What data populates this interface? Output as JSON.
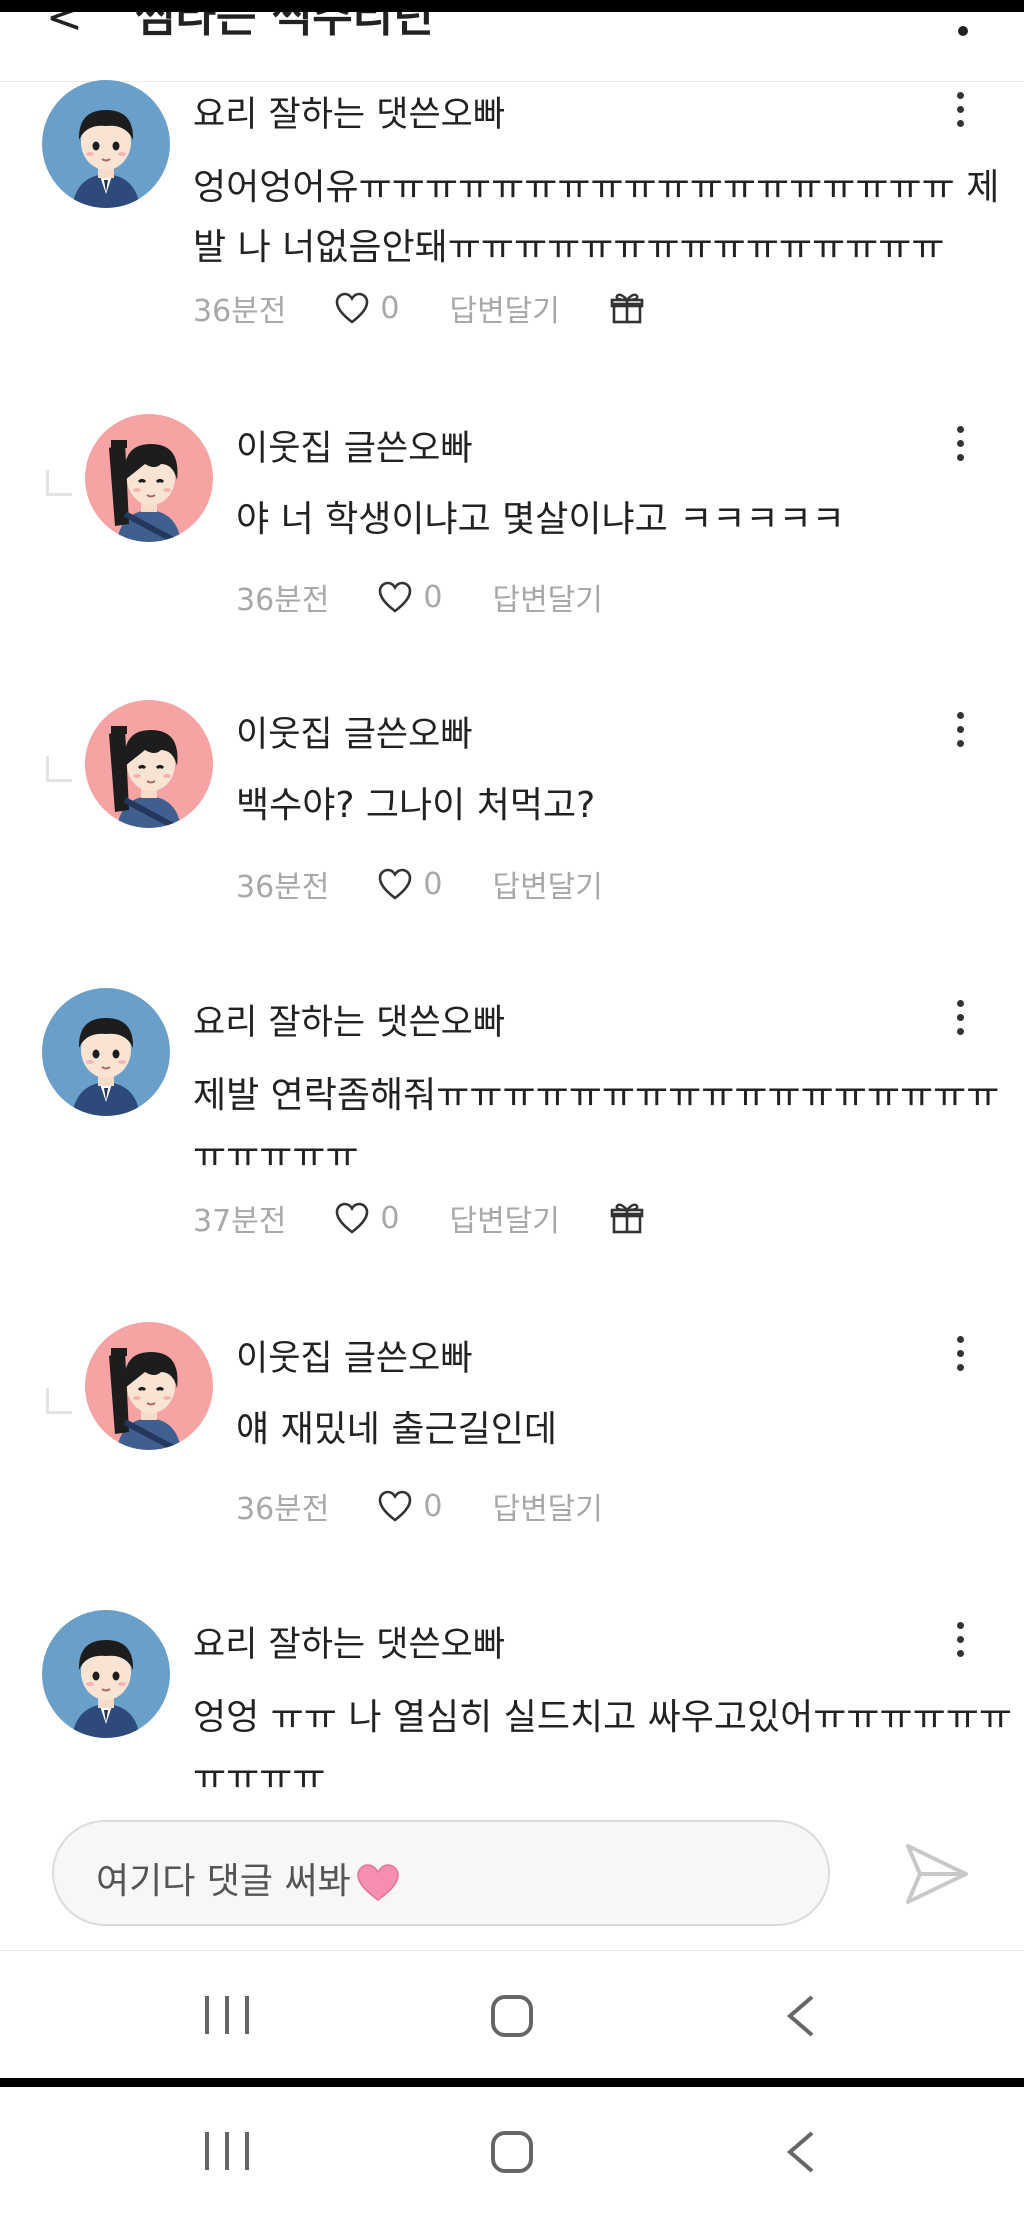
{
  "header": {
    "title": "썸타는 썩주리던",
    "back_icon": "back-arrow-icon"
  },
  "comments": [
    {
      "author": "요리 잘하는 댓쓴오빠",
      "text": "엉어엉어유ㅠㅠㅠㅠㅠㅠㅠㅠㅠㅠㅠㅠㅠㅠㅠㅠㅠㅠ 제발 나 너없음안돼ㅠㅠㅠㅠㅠㅠㅠㅠㅠㅠㅠㅠㅠㅠㅠ",
      "time": "36분전",
      "likes": "0",
      "reply_label": "답변달기",
      "is_reply": false,
      "avatar": "boy-avatar-blue",
      "has_gift": true
    },
    {
      "author": "이웃집 글쓴오빠",
      "text": "야 너 학생이냐고 몇살이냐고 ㅋㅋㅋㅋㅋ",
      "time": "36분전",
      "likes": "0",
      "reply_label": "답변달기",
      "is_reply": true,
      "avatar": "boy-avatar-pink",
      "has_gift": false
    },
    {
      "author": "이웃집 글쓴오빠",
      "text": "백수야? 그나이 처먹고?",
      "time": "36분전",
      "likes": "0",
      "reply_label": "답변달기",
      "is_reply": true,
      "avatar": "boy-avatar-pink",
      "has_gift": false
    },
    {
      "author": "요리 잘하는 댓쓴오빠",
      "text": "제발 연락좀해줘ㅠㅠㅠㅠㅠㅠㅠㅠㅠㅠㅠㅠㅠㅠㅠㅠㅠㅠㅠㅠㅠㅠ",
      "time": "37분전",
      "likes": "0",
      "reply_label": "답변달기",
      "is_reply": false,
      "avatar": "boy-avatar-blue",
      "has_gift": true
    },
    {
      "author": "이웃집 글쓴오빠",
      "text": "얘 재밌네 출근길인데",
      "time": "36분전",
      "likes": "0",
      "reply_label": "답변달기",
      "is_reply": true,
      "avatar": "boy-avatar-pink",
      "has_gift": false
    },
    {
      "author": "요리 잘하는 댓쓴오빠",
      "text": "엉엉 ㅠㅠ 나 열심히 실드치고 싸우고있어ㅠㅠㅠㅠㅠㅠㅠㅠㅠㅠ",
      "is_reply": false,
      "avatar": "boy-avatar-blue"
    }
  ],
  "input": {
    "placeholder": "여기다 댓글 써봐",
    "heart_icon": "pink-heart-emoji",
    "send_icon": "send-arrow-icon"
  },
  "navbar": {
    "icons": [
      "recent-apps-icon",
      "home-icon",
      "back-icon"
    ]
  },
  "colors": {
    "avatar_blue_bg": "#6a9fc9",
    "avatar_pink_bg": "#f5a3a3",
    "meta_gray": "#a8a8a8",
    "heart_pink": "#f48fb1"
  }
}
